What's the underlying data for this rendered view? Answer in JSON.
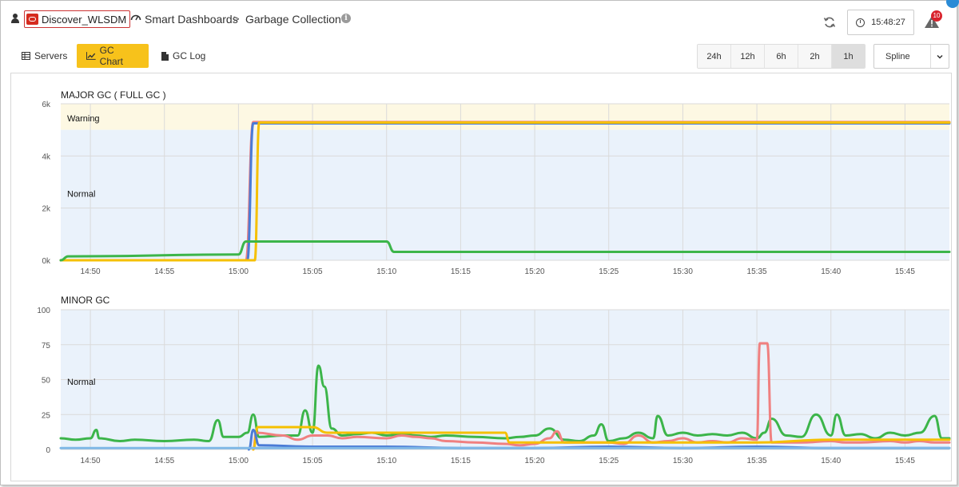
{
  "header": {
    "env_name": "Discover_WLSDM",
    "crumb_1": "Smart Dashboards",
    "crumb_2": "Garbage Collection",
    "time": "15:48:27",
    "alert_count": "10"
  },
  "tabs": [
    {
      "label": "Servers"
    },
    {
      "label": "GC Chart"
    },
    {
      "label": "GC Log"
    }
  ],
  "active_tab": "GC Chart",
  "ranges": [
    {
      "label": "24h"
    },
    {
      "label": "12h"
    },
    {
      "label": "6h"
    },
    {
      "label": "2h"
    },
    {
      "label": "1h"
    }
  ],
  "active_range": "1h",
  "chart_type_select": "Spline",
  "colors": {
    "accent": "#f7c21b",
    "green": "#3cb54a",
    "red": "#f08080",
    "yellow": "#f5c000",
    "blue": "#4a7bd6",
    "lightblue": "#7fb8e6",
    "band_normal": "#eaf2fb",
    "band_warning": "#fdf8e3"
  },
  "chart_data": [
    {
      "type": "line",
      "title": "MAJOR GC ( FULL GC )",
      "x_ticks": [
        "14:50",
        "14:55",
        "15:00",
        "15:05",
        "15:10",
        "15:15",
        "15:20",
        "15:25",
        "15:30",
        "15:35",
        "15:40",
        "15:45"
      ],
      "y_ticks": [
        "0k",
        "2k",
        "4k",
        "6k"
      ],
      "ylim": [
        0,
        6000
      ],
      "xlim": [
        "14:48",
        "15:48"
      ],
      "bands": [
        {
          "label": "Warning",
          "from": 5000,
          "to": 6000
        },
        {
          "label": "Normal",
          "from": 0,
          "to": 5000
        }
      ],
      "series": [
        {
          "color": "#f08080",
          "points": [
            [
              "14:48",
              0
            ],
            [
              "15:00.5",
              0
            ],
            [
              "15:01",
              5300
            ],
            [
              "15:48",
              5300
            ]
          ]
        },
        {
          "color": "#4a7bd6",
          "points": [
            [
              "14:48",
              0
            ],
            [
              "15:00.6",
              0
            ],
            [
              "15:01",
              5250
            ],
            [
              "15:48",
              5250
            ]
          ]
        },
        {
          "color": "#f5c000",
          "points": [
            [
              "14:48",
              0
            ],
            [
              "15:01.1",
              0
            ],
            [
              "15:01.4",
              5280
            ],
            [
              "15:48",
              5280
            ]
          ]
        },
        {
          "color": "#3cb54a",
          "points": [
            [
              "14:48",
              0
            ],
            [
              "14:48.5",
              150
            ],
            [
              "15:00",
              220
            ],
            [
              "15:00.5",
              720
            ],
            [
              "15:10",
              720
            ],
            [
              "15:10.5",
              320
            ],
            [
              "15:48",
              320
            ]
          ]
        }
      ]
    },
    {
      "type": "line",
      "title": "MINOR GC",
      "x_ticks": [
        "14:50",
        "14:55",
        "15:00",
        "15:05",
        "15:10",
        "15:15",
        "15:20",
        "15:25",
        "15:30",
        "15:35",
        "15:40",
        "15:45"
      ],
      "y_ticks": [
        "0",
        "25",
        "50",
        "75",
        "100"
      ],
      "ylim": [
        0,
        100
      ],
      "xlim": [
        "14:48",
        "15:48"
      ],
      "bands": [
        {
          "label": "Normal",
          "from": 0,
          "to": 100
        }
      ],
      "series": [
        {
          "color": "#3cb54a",
          "points": [
            [
              "14:48",
              8
            ],
            [
              "14:49",
              7
            ],
            [
              "14:50",
              8
            ],
            [
              "14:50.4",
              14
            ],
            [
              "14:50.6",
              8
            ],
            [
              "14:52",
              6
            ],
            [
              "14:53",
              7
            ],
            [
              "14:55",
              6
            ],
            [
              "14:57",
              7
            ],
            [
              "14:58",
              6
            ],
            [
              "14:58.6",
              21
            ],
            [
              "14:59",
              9
            ],
            [
              "15:00",
              9
            ],
            [
              "15:00.6",
              12
            ],
            [
              "15:01",
              25
            ],
            [
              "15:01.4",
              9
            ],
            [
              "15:03",
              10
            ],
            [
              "15:04",
              10
            ],
            [
              "15:04.5",
              28
            ],
            [
              "15:05",
              12
            ],
            [
              "15:05.4",
              60
            ],
            [
              "15:05.8",
              45
            ],
            [
              "15:06.3",
              15
            ],
            [
              "15:07",
              10
            ],
            [
              "15:08",
              11
            ],
            [
              "15:09",
              12
            ],
            [
              "15:10",
              10
            ],
            [
              "15:11",
              11
            ],
            [
              "15:12",
              10
            ],
            [
              "15:13",
              9
            ],
            [
              "15:14",
              10
            ],
            [
              "15:16",
              9
            ],
            [
              "15:18",
              8
            ],
            [
              "15:19",
              9
            ],
            [
              "15:20",
              10
            ],
            [
              "15:21",
              15
            ],
            [
              "15:22",
              7
            ],
            [
              "15:23",
              6
            ],
            [
              "15:24",
              10
            ],
            [
              "15:24.5",
              18
            ],
            [
              "15:25",
              6
            ],
            [
              "15:26",
              8
            ],
            [
              "15:27",
              12
            ],
            [
              "15:28",
              8
            ],
            [
              "15:28.3",
              24
            ],
            [
              "15:29",
              10
            ],
            [
              "15:30",
              12
            ],
            [
              "15:31",
              10
            ],
            [
              "15:32",
              11
            ],
            [
              "15:33",
              10
            ],
            [
              "15:34",
              12
            ],
            [
              "15:35",
              8
            ],
            [
              "15:35.5",
              12
            ],
            [
              "15:36",
              22
            ],
            [
              "15:37",
              10
            ],
            [
              "15:38",
              9
            ],
            [
              "15:39",
              25
            ],
            [
              "15:40",
              10
            ],
            [
              "15:40.4",
              25
            ],
            [
              "15:41",
              10
            ],
            [
              "15:42",
              11
            ],
            [
              "15:43",
              8
            ],
            [
              "15:44",
              12
            ],
            [
              "15:45",
              10
            ],
            [
              "15:46",
              12
            ],
            [
              "15:47",
              24
            ],
            [
              "15:47.5",
              8
            ],
            [
              "15:48",
              8
            ]
          ]
        },
        {
          "color": "#f08080",
          "points": [
            [
              "15:01",
              0
            ],
            [
              "15:01.2",
              12
            ],
            [
              "15:03",
              10
            ],
            [
              "15:04",
              7
            ],
            [
              "15:05",
              10
            ],
            [
              "15:06",
              10
            ],
            [
              "15:07",
              8
            ],
            [
              "15:08",
              9
            ],
            [
              "15:10",
              8
            ],
            [
              "15:11",
              10
            ],
            [
              "15:12",
              9
            ],
            [
              "15:13",
              8
            ],
            [
              "15:14",
              6
            ],
            [
              "15:16",
              5
            ],
            [
              "15:18",
              4
            ],
            [
              "15:19",
              3
            ],
            [
              "15:20",
              4
            ],
            [
              "15:21",
              8
            ],
            [
              "15:21.5",
              13
            ],
            [
              "15:22",
              5
            ],
            [
              "15:24",
              5
            ],
            [
              "15:25",
              5
            ],
            [
              "15:26",
              4
            ],
            [
              "15:27",
              10
            ],
            [
              "15:28",
              5
            ],
            [
              "15:29",
              6
            ],
            [
              "15:30",
              8
            ],
            [
              "15:31",
              5
            ],
            [
              "15:32",
              6
            ],
            [
              "15:33",
              5
            ],
            [
              "15:34",
              8
            ],
            [
              "15:35",
              7
            ],
            [
              "15:35.2",
              76
            ],
            [
              "15:35.7",
              76
            ],
            [
              "15:36",
              5
            ],
            [
              "15:38",
              5
            ],
            [
              "15:40",
              6
            ],
            [
              "15:41",
              5
            ],
            [
              "15:42",
              5
            ],
            [
              "15:44",
              6
            ],
            [
              "15:45",
              5
            ],
            [
              "15:46",
              6
            ],
            [
              "15:47",
              5
            ],
            [
              "15:48",
              5
            ]
          ]
        },
        {
          "color": "#f5c000",
          "points": [
            [
              "15:01",
              0
            ],
            [
              "15:01.3",
              16
            ],
            [
              "15:05",
              16
            ],
            [
              "15:06",
              12
            ],
            [
              "15:10",
              12
            ],
            [
              "15:15",
              12
            ],
            [
              "15:18",
              12
            ],
            [
              "15:18.3",
              5
            ],
            [
              "15:25",
              5
            ],
            [
              "15:30",
              5
            ],
            [
              "15:35",
              5
            ],
            [
              "15:40",
              7
            ],
            [
              "15:48",
              7
            ]
          ]
        },
        {
          "color": "#4a7bd6",
          "points": [
            [
              "15:00.7",
              0
            ],
            [
              "15:01",
              14
            ],
            [
              "15:01.4",
              3
            ],
            [
              "15:05",
              2
            ],
            [
              "15:10",
              2
            ],
            [
              "15:15",
              1
            ],
            [
              "15:20",
              1
            ],
            [
              "15:25",
              2
            ],
            [
              "15:30",
              1
            ],
            [
              "15:35",
              2
            ],
            [
              "15:40",
              1
            ],
            [
              "15:45",
              1
            ],
            [
              "15:48",
              1
            ]
          ]
        },
        {
          "color": "#7fb8e6",
          "points": [
            [
              "14:48",
              1
            ],
            [
              "15:48",
              1
            ]
          ]
        }
      ]
    }
  ]
}
